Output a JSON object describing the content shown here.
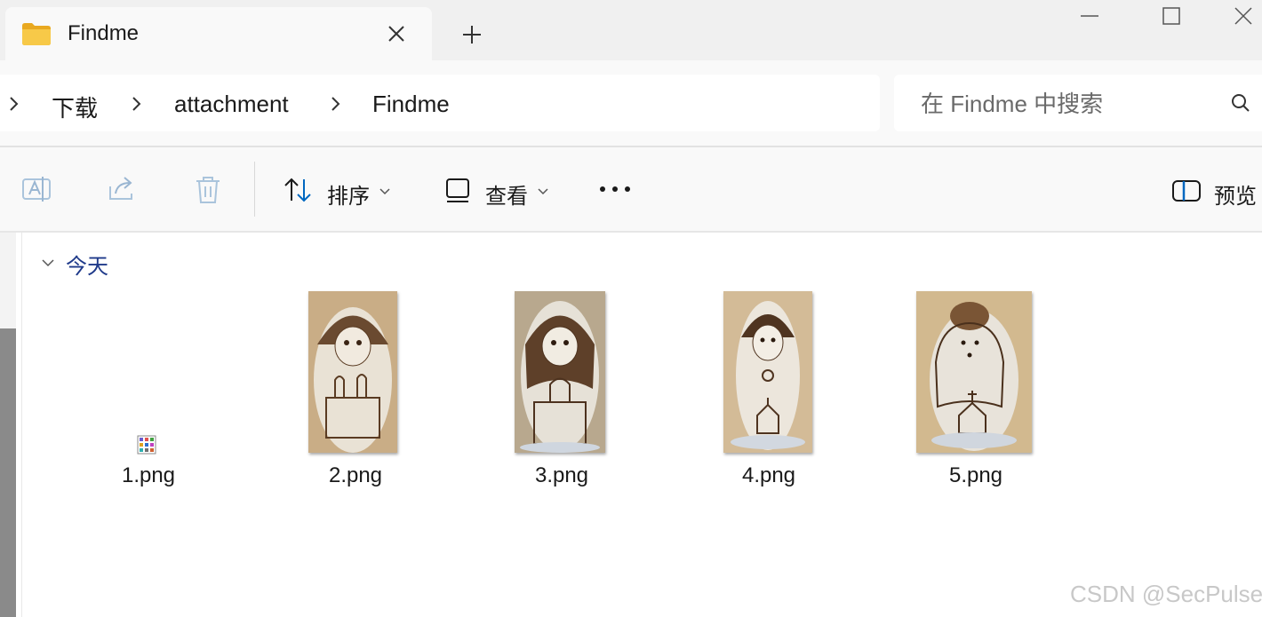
{
  "window": {
    "tab_title": "Findme",
    "new_tab_symbol": "+"
  },
  "breadcrumb": {
    "items": [
      "下载",
      "attachment",
      "Findme"
    ]
  },
  "search": {
    "placeholder": "在 Findme 中搜索"
  },
  "toolbar": {
    "sort_label": "排序",
    "view_label": "查看",
    "more_label": "•••",
    "preview_label": "预览"
  },
  "group": {
    "label": "今天"
  },
  "files": [
    {
      "name": "1.png"
    },
    {
      "name": "2.png"
    },
    {
      "name": "3.png"
    },
    {
      "name": "4.png"
    },
    {
      "name": "5.png"
    }
  ],
  "watermark": "CSDN @SecPulse",
  "icons": {
    "folder": "folder-icon",
    "close": "close-icon",
    "add": "plus-icon",
    "minimize": "minimize-icon",
    "maximize": "maximize-icon",
    "window_close": "close-icon",
    "chevron": "chevron-right-icon",
    "search": "search-icon",
    "rename": "rename-icon",
    "share": "share-icon",
    "delete": "trash-icon",
    "sort": "sort-icon",
    "view": "view-icon",
    "more": "more-icon",
    "preview": "preview-pane-icon"
  },
  "colors": {
    "accent": "#0067c0",
    "group_label": "#1f3a8a",
    "folder_yellow": "#f5c343"
  }
}
